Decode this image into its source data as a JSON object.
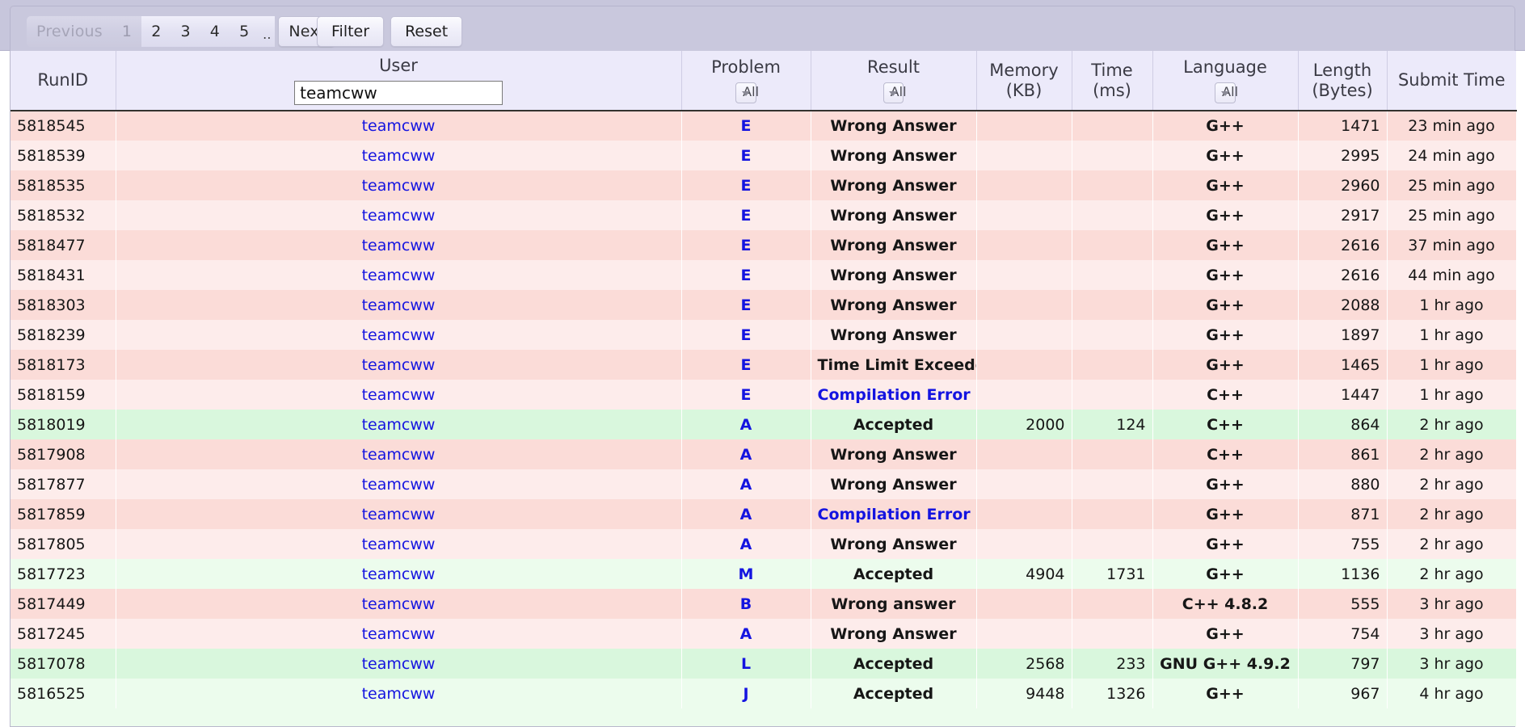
{
  "toolbar": {
    "pagination": {
      "previous_label": "Previous",
      "pages": [
        "1",
        "2",
        "3",
        "4",
        "5"
      ],
      "ellipsis": "..",
      "next_label": "Next",
      "current_page": "1"
    },
    "filter_label": "Filter",
    "reset_label": "Reset"
  },
  "table": {
    "columns": [
      {
        "key": "runid",
        "title": "RunID",
        "subtitle": "",
        "control": "none"
      },
      {
        "key": "user",
        "title": "User",
        "subtitle": "",
        "control": "input"
      },
      {
        "key": "problem",
        "title": "Problem",
        "subtitle": "",
        "control": "select"
      },
      {
        "key": "result",
        "title": "Result",
        "subtitle": "",
        "control": "select"
      },
      {
        "key": "memory",
        "title": "Memory",
        "subtitle": "(KB)",
        "control": "none"
      },
      {
        "key": "time",
        "title": "Time",
        "subtitle": "(ms)",
        "control": "none"
      },
      {
        "key": "language",
        "title": "Language",
        "subtitle": "",
        "control": "select"
      },
      {
        "key": "length",
        "title": "Length",
        "subtitle": "(Bytes)",
        "control": "none"
      },
      {
        "key": "submit",
        "title": "Submit Time",
        "subtitle": "",
        "control": "none"
      }
    ],
    "filters": {
      "user_value": "teamcww",
      "user_placeholder": "",
      "problem_value": "All",
      "result_value": "All",
      "language_value": "All"
    },
    "rows": [
      {
        "runid": "5818545",
        "user": "teamcww",
        "problem": "E",
        "result": "Wrong Answer",
        "memory": "",
        "time": "",
        "language": "G++",
        "length": "1471",
        "submit": "23 min ago",
        "state": "wrong"
      },
      {
        "runid": "5818539",
        "user": "teamcww",
        "problem": "E",
        "result": "Wrong Answer",
        "memory": "",
        "time": "",
        "language": "G++",
        "length": "2995",
        "submit": "24 min ago",
        "state": "wrong"
      },
      {
        "runid": "5818535",
        "user": "teamcww",
        "problem": "E",
        "result": "Wrong Answer",
        "memory": "",
        "time": "",
        "language": "G++",
        "length": "2960",
        "submit": "25 min ago",
        "state": "wrong"
      },
      {
        "runid": "5818532",
        "user": "teamcww",
        "problem": "E",
        "result": "Wrong Answer",
        "memory": "",
        "time": "",
        "language": "G++",
        "length": "2917",
        "submit": "25 min ago",
        "state": "wrong"
      },
      {
        "runid": "5818477",
        "user": "teamcww",
        "problem": "E",
        "result": "Wrong Answer",
        "memory": "",
        "time": "",
        "language": "G++",
        "length": "2616",
        "submit": "37 min ago",
        "state": "wrong"
      },
      {
        "runid": "5818431",
        "user": "teamcww",
        "problem": "E",
        "result": "Wrong Answer",
        "memory": "",
        "time": "",
        "language": "G++",
        "length": "2616",
        "submit": "44 min ago",
        "state": "wrong"
      },
      {
        "runid": "5818303",
        "user": "teamcww",
        "problem": "E",
        "result": "Wrong Answer",
        "memory": "",
        "time": "",
        "language": "G++",
        "length": "2088",
        "submit": "1 hr ago",
        "state": "wrong"
      },
      {
        "runid": "5818239",
        "user": "teamcww",
        "problem": "E",
        "result": "Wrong Answer",
        "memory": "",
        "time": "",
        "language": "G++",
        "length": "1897",
        "submit": "1 hr ago",
        "state": "wrong"
      },
      {
        "runid": "5818173",
        "user": "teamcww",
        "problem": "E",
        "result": "Time Limit Exceeded",
        "memory": "",
        "time": "",
        "language": "G++",
        "length": "1465",
        "submit": "1 hr ago",
        "state": "wrong"
      },
      {
        "runid": "5818159",
        "user": "teamcww",
        "problem": "E",
        "result": "Compilation Error",
        "memory": "",
        "time": "",
        "language": "C++",
        "length": "1447",
        "submit": "1 hr ago",
        "state": "wrong"
      },
      {
        "runid": "5818019",
        "user": "teamcww",
        "problem": "A",
        "result": "Accepted",
        "memory": "2000",
        "time": "124",
        "language": "C++",
        "length": "864",
        "submit": "2 hr ago",
        "state": "ok"
      },
      {
        "runid": "5817908",
        "user": "teamcww",
        "problem": "A",
        "result": "Wrong Answer",
        "memory": "",
        "time": "",
        "language": "C++",
        "length": "861",
        "submit": "2 hr ago",
        "state": "wrong"
      },
      {
        "runid": "5817877",
        "user": "teamcww",
        "problem": "A",
        "result": "Wrong Answer",
        "memory": "",
        "time": "",
        "language": "G++",
        "length": "880",
        "submit": "2 hr ago",
        "state": "wrong"
      },
      {
        "runid": "5817859",
        "user": "teamcww",
        "problem": "A",
        "result": "Compilation Error",
        "memory": "",
        "time": "",
        "language": "G++",
        "length": "871",
        "submit": "2 hr ago",
        "state": "wrong"
      },
      {
        "runid": "5817805",
        "user": "teamcww",
        "problem": "A",
        "result": "Wrong Answer",
        "memory": "",
        "time": "",
        "language": "G++",
        "length": "755",
        "submit": "2 hr ago",
        "state": "wrong"
      },
      {
        "runid": "5817723",
        "user": "teamcww",
        "problem": "M",
        "result": "Accepted",
        "memory": "4904",
        "time": "1731",
        "language": "G++",
        "length": "1136",
        "submit": "2 hr ago",
        "state": "ok"
      },
      {
        "runid": "5817449",
        "user": "teamcww",
        "problem": "B",
        "result": "Wrong answer",
        "memory": "",
        "time": "",
        "language": "C++ 4.8.2",
        "length": "555",
        "submit": "3 hr ago",
        "state": "wrong"
      },
      {
        "runid": "5817245",
        "user": "teamcww",
        "problem": "A",
        "result": "Wrong Answer",
        "memory": "",
        "time": "",
        "language": "G++",
        "length": "754",
        "submit": "3 hr ago",
        "state": "wrong"
      },
      {
        "runid": "5817078",
        "user": "teamcww",
        "problem": "L",
        "result": "Accepted",
        "memory": "2568",
        "time": "233",
        "language": "GNU G++ 4.9.2",
        "length": "797",
        "submit": "3 hr ago",
        "state": "ok"
      },
      {
        "runid": "5816525",
        "user": "teamcww",
        "problem": "J",
        "result": "Accepted",
        "memory": "9448",
        "time": "1326",
        "language": "G++",
        "length": "967",
        "submit": "4 hr ago",
        "state": "ok"
      }
    ]
  },
  "colors": {
    "toolbar_bg": "#c7c6dc",
    "header_bg": "#eceafa",
    "row_wrong_a": "#fbdcd8",
    "row_wrong_b": "#fdeceb",
    "row_ok_a": "#d9f7dd",
    "row_ok_b": "#ecfced",
    "link": "#1414e0",
    "language": "#16a016"
  }
}
